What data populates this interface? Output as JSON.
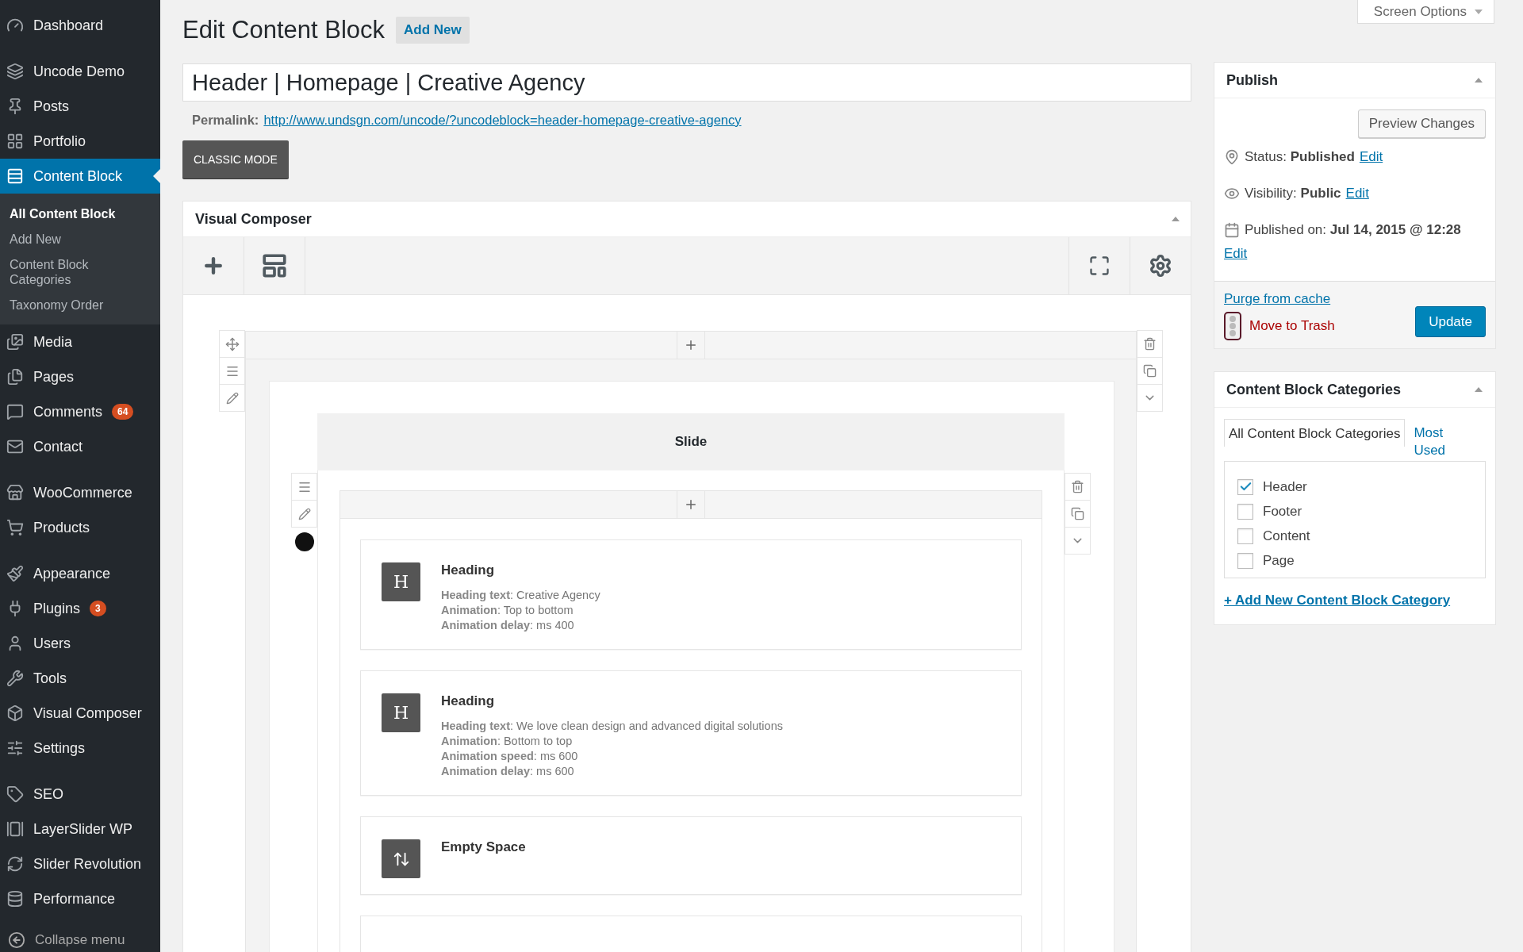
{
  "sidebar": {
    "groups": [
      [
        {
          "label": "Dashboard",
          "selected": false
        }
      ],
      [
        {
          "label": "Uncode Demo",
          "selected": false
        },
        {
          "label": "Posts",
          "selected": false
        },
        {
          "label": "Portfolio",
          "selected": false
        },
        {
          "label": "Content Block",
          "selected": true,
          "children": [
            {
              "label": "All Content Block",
              "selected": true
            },
            {
              "label": "Add New",
              "selected": false
            },
            {
              "label": "Content Block Categories",
              "selected": false
            },
            {
              "label": "Taxonomy Order",
              "selected": false
            }
          ]
        },
        {
          "label": "Media",
          "selected": false
        },
        {
          "label": "Pages",
          "selected": false
        },
        {
          "label": "Comments",
          "selected": false,
          "badge": "64"
        },
        {
          "label": "Contact",
          "selected": false
        }
      ],
      [
        {
          "label": "WooCommerce",
          "selected": false
        },
        {
          "label": "Products",
          "selected": false
        }
      ],
      [
        {
          "label": "Appearance",
          "selected": false
        },
        {
          "label": "Plugins",
          "selected": false,
          "badge": "3"
        },
        {
          "label": "Users",
          "selected": false
        },
        {
          "label": "Tools",
          "selected": false
        },
        {
          "label": "Visual Composer",
          "selected": false
        },
        {
          "label": "Settings",
          "selected": false
        }
      ],
      [
        {
          "label": "SEO",
          "selected": false
        },
        {
          "label": "LayerSlider WP",
          "selected": false
        },
        {
          "label": "Slider Revolution",
          "selected": false
        },
        {
          "label": "Performance",
          "selected": false
        }
      ]
    ],
    "collapse": "Collapse menu"
  },
  "page": {
    "title": "Edit Content Block",
    "add_new": "Add New",
    "screen_options": "Screen Options"
  },
  "post_title": {
    "value": "Header | Homepage | Creative Agency"
  },
  "permalink": {
    "label": "Permalink:",
    "url": "http://www.undsgn.com/uncode/?uncodeblock=header-homepage-creative-agency"
  },
  "classic_mode": "CLASSIC MODE",
  "composer": {
    "title": "Visual Composer",
    "slide_title": "Slide",
    "elements": [
      {
        "kind": "heading",
        "glyph": "H",
        "title": "Heading",
        "params": [
          "**Heading text**: Creative Agency",
          "**Animation**: Top to bottom",
          "**Animation delay**: ms 400"
        ]
      },
      {
        "kind": "heading",
        "glyph": "H",
        "title": "Heading",
        "params": [
          "**Heading text**: We love clean design and advanced digital solutions",
          "**Animation**: Bottom to top",
          "**Animation speed**: ms 600",
          "**Animation delay**: ms 600"
        ]
      },
      {
        "kind": "empty_space",
        "title": "Empty Space"
      },
      {
        "kind": "cut"
      }
    ]
  },
  "publish": {
    "title": "Publish",
    "preview": "Preview Changes",
    "rows": [
      {
        "kind": "status",
        "label": "Status:",
        "value": "Published",
        "link": "Edit"
      },
      {
        "kind": "visibility",
        "label": "Visibility:",
        "value": "Public",
        "link": "Edit"
      },
      {
        "kind": "date",
        "label": "Published on:",
        "value": "Jul 14, 2015 @ 12:28",
        "link": "Edit"
      }
    ],
    "purge": "Purge from cache",
    "trash": "Move to Trash",
    "update": "Update"
  },
  "categories": {
    "title": "Content Block Categories",
    "tabs": [
      {
        "label": "All Content Block Categories",
        "selected": true
      },
      {
        "label": "Most Used",
        "selected": false
      }
    ],
    "items": [
      {
        "label": "Header",
        "checked": true
      },
      {
        "label": "Footer",
        "checked": false
      },
      {
        "label": "Content",
        "checked": false
      },
      {
        "label": "Page",
        "checked": false
      }
    ],
    "add_link": "+ Add New Content Block Category"
  }
}
